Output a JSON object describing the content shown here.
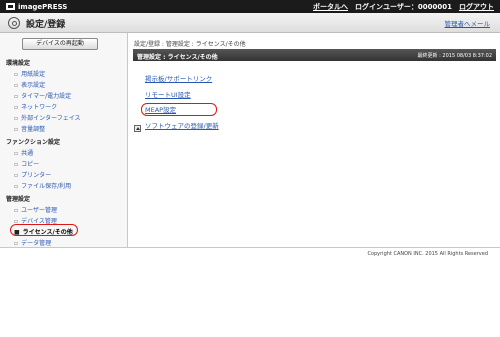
{
  "topbar": {
    "brand": "imagePRESS",
    "portal_link": "ポータルへ",
    "login_user": "ログインユーザー：0000001",
    "logout_link": "ログアウト"
  },
  "titlebar": {
    "title": "設定/登録",
    "admin_link": "管理者へメール"
  },
  "sidebar": {
    "restart_button": "デバイスの再起動",
    "sections": [
      {
        "label": "環境設定",
        "items": [
          "用紙設定",
          "表示設定",
          "タイマー/電力設定",
          "ネットワーク",
          "外部インターフェイス",
          "音量調整"
        ]
      },
      {
        "label": "ファンクション設定",
        "items": [
          "共通",
          "コピー",
          "プリンター",
          "ファイル保存/利用"
        ]
      },
      {
        "label": "管理設定",
        "items": [
          "ユーザー管理",
          "デバイス管理",
          "ライセンス/その他",
          "データ管理"
        ]
      }
    ],
    "active_item": "ライセンス/その他"
  },
  "main": {
    "breadcrumb": "設定/登録 : 管理設定 : ライセンス/その他",
    "header_title": "管理設定 : ライセンス/その他",
    "last_updated": "最終更新 : 2015 08/03 8:37:02",
    "links": [
      "掲示板/サポートリンク",
      "リモートUI設定",
      "MEAP設定",
      "ソフトウェアの登録/更新"
    ]
  },
  "footer": {
    "copyright": "Copyright CANON INC. 2015 All Rights Reserved"
  },
  "colors": {
    "highlight_circle": "#e01515",
    "link": "#2a58b0",
    "topbar_bg": "#1b1b1b"
  }
}
